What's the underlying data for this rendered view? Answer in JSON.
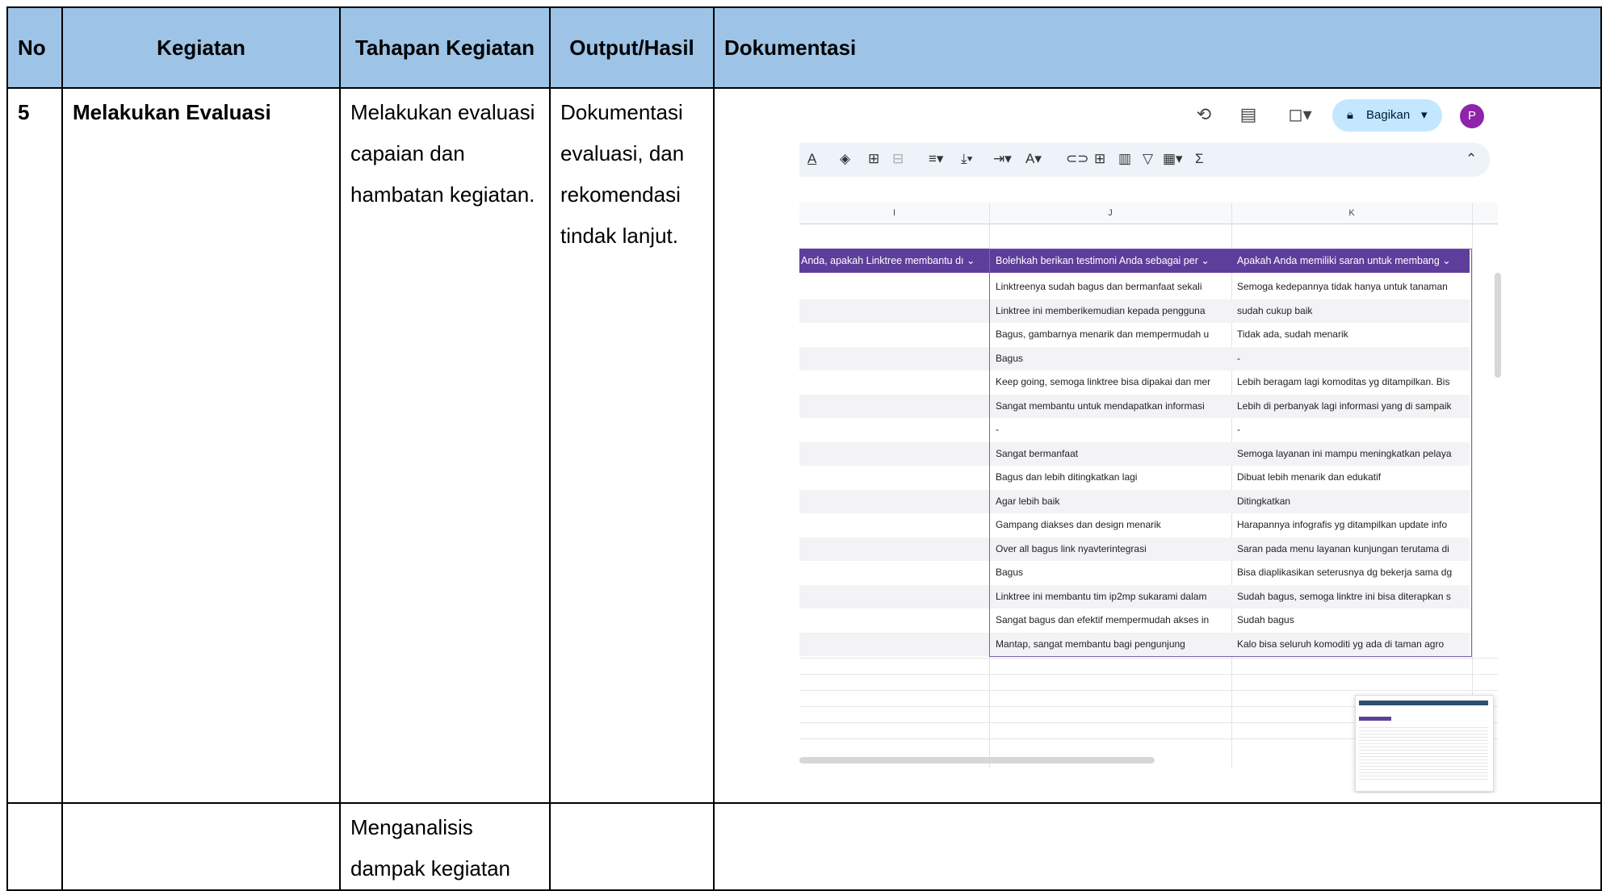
{
  "table": {
    "headers": {
      "no": "No",
      "kegiatan": "Kegiatan",
      "tahapan": "Tahapan Kegiatan",
      "output": "Output/Hasil",
      "dokumentasi": "Dokumentasi"
    },
    "rows": [
      {
        "no": "5",
        "kegiatan": "Melakukan Evaluasi",
        "tahapan": "Melakukan evaluasi capaian dan hambatan kegiatan.",
        "output": "Dokumentasi evaluasi, dan rekomendasi tindak lanjut."
      },
      {
        "no": "",
        "kegiatan": "",
        "tahapan": "Menganalisis dampak kegiatan",
        "output": ""
      }
    ]
  },
  "screenshot": {
    "share_label": "Bagikan",
    "avatar_letter": "P",
    "column_letters": [
      "I",
      "J",
      "K"
    ],
    "column_headers": [
      "Anda, apakah Linktree membantu dı ⌄",
      "Bolehkah berikan testimoni Anda sebagai per ⌄",
      "Apakah Anda memiliki saran untuk membang ⌄"
    ],
    "rows": [
      [
        "Linktreenya sudah bagus dan bermanfaat sekali",
        "Semoga kedepannya tidak hanya untuk tanaman"
      ],
      [
        "Linktree ini memberikemudian kepada pengguna",
        "sudah cukup baik"
      ],
      [
        "Bagus, gambarnya menarik dan mempermudah u",
        "Tidak ada, sudah menarik"
      ],
      [
        "Bagus",
        "-"
      ],
      [
        "Keep going, semoga linktree bisa dipakai dan mer",
        "Lebih beragam lagi komoditas yg ditampilkan. Bis"
      ],
      [
        "Sangat membantu untuk mendapatkan informasi",
        "Lebih di perbanyak lagi informasi yang di sampaik"
      ],
      [
        "-",
        "-"
      ],
      [
        "Sangat bermanfaat",
        "Semoga layanan ini mampu meningkatkan pelaya"
      ],
      [
        "Bagus dan lebih ditingkatkan lagi",
        "Dibuat lebih menarik dan edukatif"
      ],
      [
        "Agar lebih baik",
        "Ditingkatkan"
      ],
      [
        "Gampang diakses dan design menarik",
        "Harapannya infografis yg ditampilkan update info"
      ],
      [
        "Over all bagus link nyavterintegrasi",
        "Saran pada menu layanan kunjungan terutama di"
      ],
      [
        "Bagus",
        "Bisa diaplikasikan seterusnya dg bekerja sama dg"
      ],
      [
        "Linktree ini membantu tim ip2mp sukarami dalam",
        "Sudah bagus, semoga linktre ini bisa diterapkan s"
      ],
      [
        "Sangat bagus dan efektif mempermudah akses in",
        "Sudah bagus"
      ],
      [
        "Mantap, sangat membantu bagi pengunjung",
        "Kalo  bisa seluruh komoditi yg ada di taman agro"
      ]
    ]
  }
}
